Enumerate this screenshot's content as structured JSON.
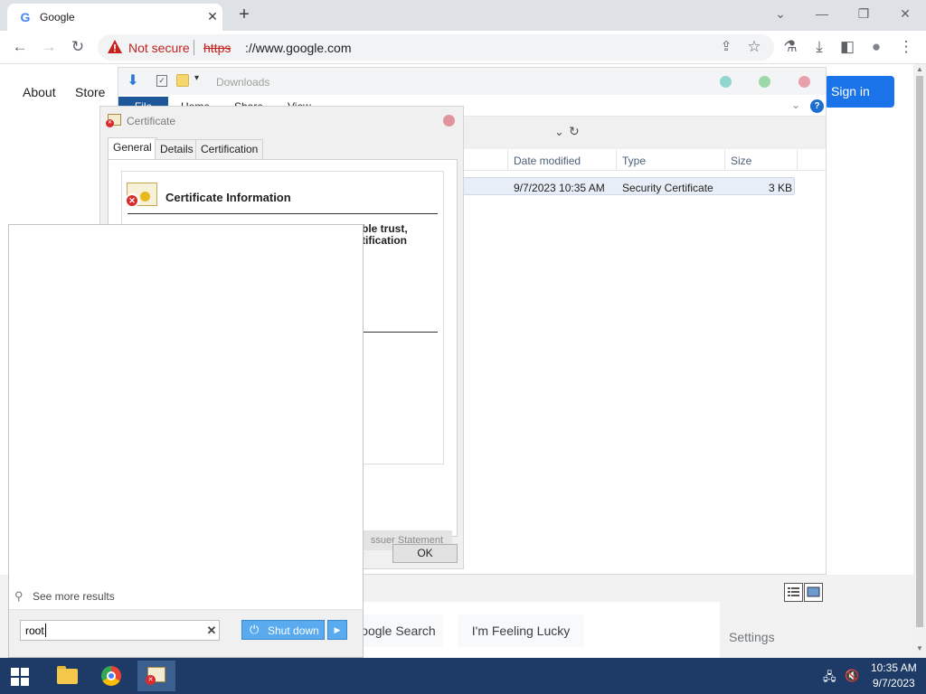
{
  "browser": {
    "tab": {
      "title": "Google",
      "favicon": "G",
      "close_glyph": "✕"
    },
    "new_tab_glyph": "+",
    "window_controls": {
      "tabsearch": "⌄",
      "minimize": "—",
      "restore": "❐",
      "close": "✕"
    },
    "nav": {
      "back": "←",
      "forward": "→",
      "reload": "↻"
    },
    "omnibox": {
      "security_label": "Not secure",
      "url_scheme": "https",
      "url_rest": "://www.google.com"
    },
    "toolbar_icons": {
      "share": "⇪",
      "bookmark": "☆",
      "labs": "⚗",
      "download": "⤓",
      "sidepanel": "◧",
      "profile": "●",
      "menu": "⋮"
    }
  },
  "google_page": {
    "about": "About",
    "store": "Store",
    "sign_in": "Sign in",
    "search_button": "Google Search",
    "lucky_button": "I'm Feeling Lucky",
    "settings": "Settings"
  },
  "explorer": {
    "title": "Downloads",
    "ribbon_tabs": [
      "File",
      "Home",
      "Share",
      "View"
    ],
    "help_glyph": "?",
    "columns": [
      "Date modified",
      "Type",
      "Size"
    ],
    "file_row": {
      "date_modified": "9/7/2023 10:35 AM",
      "type": "Security Certificate",
      "size": "3 KB"
    },
    "accent_color": "#1e5799"
  },
  "certificate_dialog": {
    "title": "Certificate",
    "tabs": [
      "General",
      "Details",
      "Certification Path"
    ],
    "info_heading": "Certificate Information",
    "body_line1": "ble trust,",
    "body_line2": "tification",
    "issuer_button": "ssuer Statement",
    "ok_button": "OK"
  },
  "start_menu": {
    "see_more": "See more results",
    "search_value": "root",
    "clear_glyph": "✕",
    "shutdown_label": "Shut down",
    "shutdown_arrow": "▶"
  },
  "taskbar": {
    "time": "10:35 AM",
    "date": "9/7/2023"
  }
}
